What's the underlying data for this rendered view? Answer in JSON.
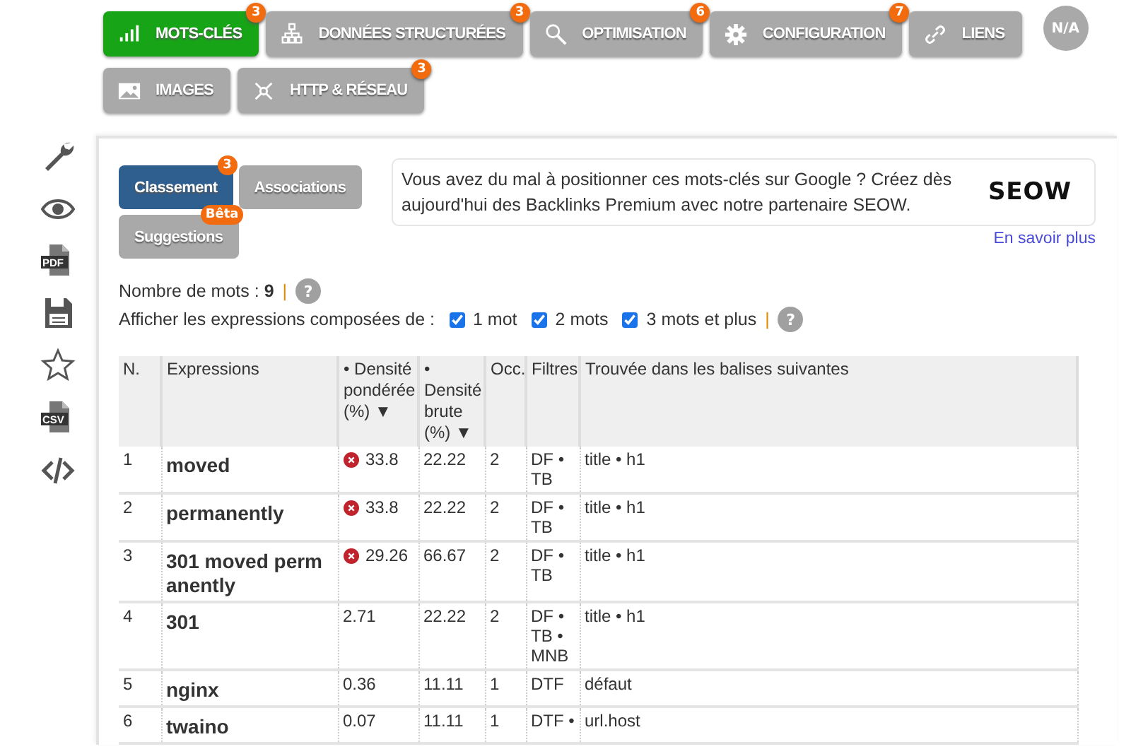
{
  "nav": {
    "tabs": [
      {
        "label": "MOTS-CLÉS",
        "selected": true,
        "badge": "3"
      },
      {
        "label": "DONNÉES STRUCTURÉES",
        "selected": false,
        "badge": "3"
      },
      {
        "label": "OPTIMISATION",
        "selected": false,
        "badge": "6"
      },
      {
        "label": "CONFIGURATION",
        "selected": false,
        "badge": "7"
      },
      {
        "label": "LIENS",
        "selected": false
      },
      {
        "label": "IMAGES",
        "selected": false
      },
      {
        "label": "HTTP & RÉSEAU",
        "selected": false,
        "badge": "3"
      }
    ],
    "status": "N/A"
  },
  "sidebar": [
    {
      "kind": "wrench"
    },
    {
      "kind": "eye"
    },
    {
      "kind": "file",
      "label": "PDF"
    },
    {
      "kind": "save"
    },
    {
      "kind": "star"
    },
    {
      "kind": "file",
      "label": "CSV"
    },
    {
      "kind": "code"
    }
  ],
  "subtabs": [
    {
      "label": "Classement",
      "selected": true,
      "badge": "3"
    },
    {
      "label": "Associations",
      "selected": false
    },
    {
      "label": "Suggestions",
      "selected": false,
      "badge": "Bêta"
    }
  ],
  "promo": {
    "text": "Vous avez du mal à positionner ces mots-clés sur Google ? Créez dès aujourd'hui des Backlinks Premium avec notre partenaire SEOW.",
    "logo": "SEOW",
    "link": "En savoir plus"
  },
  "word_count": {
    "text": "Nombre de mots : **9**",
    "separator": "|",
    "help": "?"
  },
  "filter": {
    "label": "Afficher les expressions composées de :",
    "options": [
      {
        "label": "1 mot",
        "checked": true
      },
      {
        "label": "2 mots",
        "checked": true
      },
      {
        "label": "3 mots et plus",
        "checked": true
      }
    ],
    "separator": "|",
    "help": "?"
  },
  "table": {
    "columns": [
      "N.",
      "Expressions",
      "• Densité pondérée (%) ▼",
      "• Densité brute (%) ▼",
      "Occ.",
      "Filtres",
      "Trouvée dans les balises suivantes"
    ],
    "rows": [
      {
        "n": "1",
        "expression": "moved",
        "warning": true,
        "weighted": "33.8",
        "raw": "22.22",
        "occ": "2",
        "filters": "DF • TB",
        "found": "title • h1"
      },
      {
        "n": "2",
        "expression": "permanently",
        "warning": true,
        "weighted": "33.8",
        "raw": "22.22",
        "occ": "2",
        "filters": "DF • TB",
        "found": "title • h1"
      },
      {
        "n": "3",
        "expression": "301 moved perm anently",
        "warning": true,
        "weighted": "29.26",
        "raw": "66.67",
        "occ": "2",
        "filters": "DF • TB",
        "found": "title • h1"
      },
      {
        "n": "4",
        "expression": "301",
        "warning": false,
        "weighted": "2.71",
        "raw": "22.22",
        "occ": "2",
        "filters": "DF • TB • MNB",
        "found": "title • h1"
      },
      {
        "n": "5",
        "expression": "nginx",
        "warning": false,
        "weighted": "0.36",
        "raw": "11.11",
        "occ": "1",
        "filters": "DTF",
        "found": "défaut"
      },
      {
        "n": "6",
        "expression": "twaino",
        "warning": false,
        "weighted": "0.07",
        "raw": "11.11",
        "occ": "1",
        "filters": "DTF •",
        "found": "url.host"
      }
    ]
  }
}
